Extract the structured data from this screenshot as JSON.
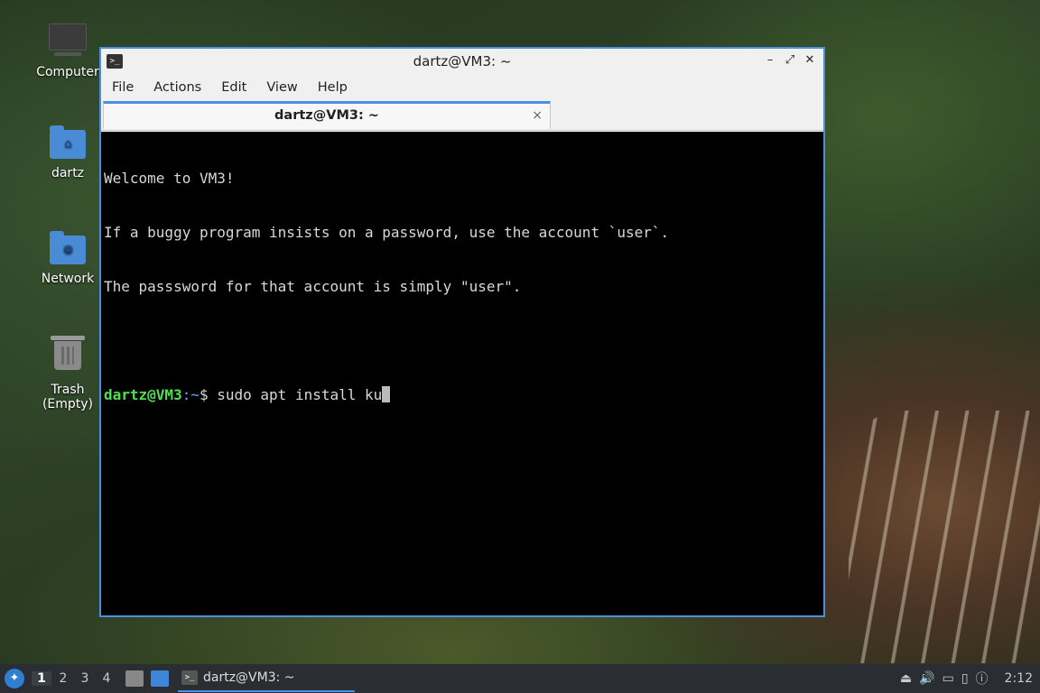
{
  "desktop": {
    "icons": [
      {
        "label": "Computer"
      },
      {
        "label": "dartz"
      },
      {
        "label": "Network"
      },
      {
        "label": "Trash (Empty)"
      }
    ]
  },
  "window": {
    "title": "dartz@VM3: ~",
    "menu": [
      "File",
      "Actions",
      "Edit",
      "View",
      "Help"
    ],
    "tab_title": "dartz@VM3: ~",
    "tab_close": "×",
    "buttons": {
      "minimize": "–",
      "maximize": "⤢",
      "close": "✕"
    }
  },
  "terminal": {
    "lines": [
      "Welcome to VM3!",
      "If a buggy program insists on a password, use the account `user`.",
      "The passsword for that account is simply \"user\".",
      ""
    ],
    "prompt_user": "dartz@VM3",
    "prompt_sep": ":",
    "prompt_path": "~",
    "prompt_symbol": "$ ",
    "command": "sudo apt install ku"
  },
  "taskbar": {
    "workspaces": [
      "1",
      "2",
      "3",
      "4"
    ],
    "active_workspace": "1",
    "task_label": "dartz@VM3: ~",
    "clock": "2:12"
  },
  "colors": {
    "accent": "#4a90e2",
    "prompt_user": "#4ee04e",
    "prompt_path": "#6aa6ff"
  }
}
